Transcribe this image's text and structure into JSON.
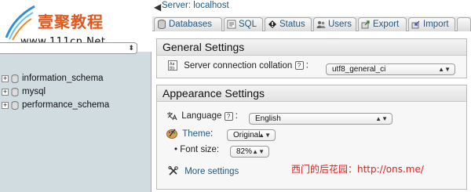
{
  "logo": {
    "title_cn": "壹聚教程",
    "url": "www.111cn.Net"
  },
  "sidebar": {
    "databases": [
      {
        "name": "information_schema"
      },
      {
        "name": "mysql"
      },
      {
        "name": "performance_schema"
      }
    ]
  },
  "header": {
    "back_icon": "arrow-left-icon",
    "server_label": "Server: localhost"
  },
  "tabs": [
    {
      "label": "Databases",
      "icon": "databases-icon"
    },
    {
      "label": "SQL",
      "icon": "sql-icon"
    },
    {
      "label": "Status",
      "icon": "status-icon"
    },
    {
      "label": "Users",
      "icon": "users-icon"
    },
    {
      "label": "Export",
      "icon": "export-icon"
    },
    {
      "label": "Import",
      "icon": "import-icon"
    }
  ],
  "general_settings": {
    "title": "General Settings",
    "collation_label": "Server connection collation",
    "collation_value": "utf8_general_ci"
  },
  "appearance_settings": {
    "title": "Appearance Settings",
    "language_label": "Language",
    "language_value": "English",
    "theme_label": "Theme",
    "theme_value": "Original",
    "font_size_label": "Font size:",
    "font_size_value": "82%",
    "more_settings": "More settings"
  },
  "watermark": "西门的后花园：http://ons.me/",
  "colors": {
    "link": "#235a81",
    "sidebar_bg": "#d0dce0",
    "watermark": "#e02020",
    "logo_text": "#e0581e"
  }
}
